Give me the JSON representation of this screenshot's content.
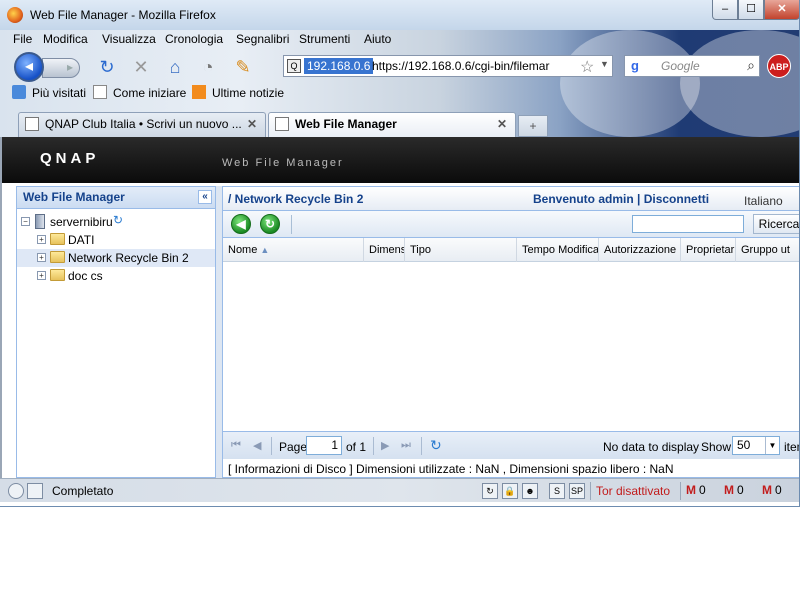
{
  "window": {
    "title": "Web File Manager - Mozilla Firefox",
    "min_label": "‒",
    "max_label": "☐",
    "close_label": "✕"
  },
  "menu": [
    "File",
    "Modifica",
    "Visualizza",
    "Cronologia",
    "Segnalibri",
    "Strumenti",
    "Aiuto"
  ],
  "nav": {
    "site_badge": "192.168.0.6",
    "url": "https://192.168.0.6/cgi-bin/filemar",
    "search_placeholder": "Google"
  },
  "bookmarks": [
    "Più visitati",
    "Come iniziare",
    "Ultime notizie"
  ],
  "tabs": [
    {
      "label": "QNAP Club Italia • Scrivi un nuovo ...",
      "active": false
    },
    {
      "label": "Web File Manager",
      "active": true
    }
  ],
  "app": {
    "logo": "QNAP",
    "subtitle": "Web File Manager"
  },
  "left_panel": {
    "title": "Web File Manager",
    "collapse_glyph": "«",
    "tree": [
      {
        "label": "servernibiru",
        "type": "server"
      },
      {
        "label": "DATI",
        "type": "folder"
      },
      {
        "label": "Network Recycle Bin 2",
        "type": "folder",
        "selected": true
      },
      {
        "label": "doc cs",
        "type": "folder"
      }
    ]
  },
  "main_panel": {
    "path": "/ Network Recycle Bin 2",
    "welcome": "Benvenuto admin | Disconnetti",
    "language": "Italiano",
    "search_button": "Ricerca",
    "columns": [
      "Nome",
      "Dimens",
      "Tipo",
      "Tempo Modifica",
      "Autorizzazione",
      "Proprietar",
      "Gruppo ut"
    ],
    "pager": {
      "page_label": "Page",
      "page_value": "1",
      "of_label": "of 1",
      "no_data": "No data to display",
      "show_label": "Show",
      "show_value": "50",
      "items_label": "item"
    },
    "status": "[ Informazioni di Disco ] Dimensioni utilizzate : NaN , Dimensioni spazio libero : NaN"
  },
  "statusbar": {
    "text": "Completato",
    "tor": "Tor disattivato",
    "gmail": [
      "0",
      "0",
      "0"
    ]
  }
}
